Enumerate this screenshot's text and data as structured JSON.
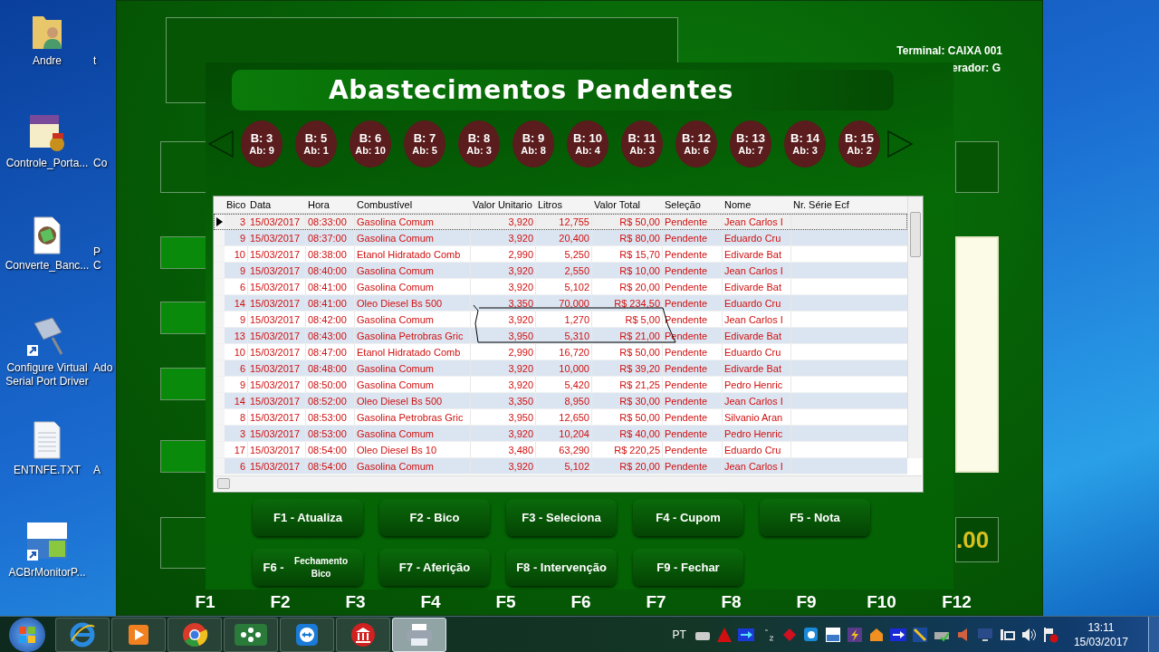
{
  "desktop_icons": [
    {
      "kind": "folder",
      "label": "Andre"
    },
    {
      "kind": "pas",
      "label": "Controle_Porta..."
    },
    {
      "kind": "doc",
      "label": "Converte_Banc..."
    },
    {
      "kind": "plug",
      "label": "Configure Virtual Serial Port Driver"
    },
    {
      "kind": "text",
      "label": "ENTNFE.TXT"
    },
    {
      "kind": "acbr",
      "label": "ACBrMonitorP..."
    }
  ],
  "desktop_icons_partial": [
    "t",
    "Co",
    "P\nC",
    "Ado",
    "A"
  ],
  "back_window": {
    "terminal": "Terminal: CAIXA 001",
    "operator": "erador: G",
    "total": ".00",
    "fkeys": [
      "F1",
      "F2",
      "F3",
      "F4",
      "F5",
      "F6",
      "F7",
      "F8",
      "F9",
      "F10",
      "F12"
    ]
  },
  "dialog": {
    "title": "Abastecimentos Pendentes",
    "bicos": [
      {
        "b": "B: 3",
        "ab": "Ab: 9"
      },
      {
        "b": "B: 5",
        "ab": "Ab: 1"
      },
      {
        "b": "B: 6",
        "ab": "Ab: 10"
      },
      {
        "b": "B: 7",
        "ab": "Ab: 5"
      },
      {
        "b": "B: 8",
        "ab": "Ab: 3"
      },
      {
        "b": "B: 9",
        "ab": "Ab: 8"
      },
      {
        "b": "B: 10",
        "ab": "Ab: 4"
      },
      {
        "b": "B: 11",
        "ab": "Ab: 3"
      },
      {
        "b": "B: 12",
        "ab": "Ab: 6"
      },
      {
        "b": "B: 13",
        "ab": "Ab: 7"
      },
      {
        "b": "B: 14",
        "ab": "Ab: 3"
      },
      {
        "b": "B: 15",
        "ab": "Ab: 2"
      }
    ],
    "table": {
      "columns": [
        "Bico",
        "Data",
        "Hora",
        "Combustível",
        "Valor Unitario",
        "Litros",
        "Valor Total",
        "Seleção",
        "Nome",
        "Nr. Série Ecf"
      ],
      "rows": [
        {
          "selected": true,
          "cells": [
            "3",
            "15/03/2017",
            "08:33:00",
            "Gasolina Comum",
            "3,920",
            "12,755",
            "R$ 50,00",
            "Pendente",
            "Jean Carlos I"
          ]
        },
        {
          "selected": false,
          "cells": [
            "9",
            "15/03/2017",
            "08:37:00",
            "Gasolina Comum",
            "3,920",
            "20,400",
            "R$ 80,00",
            "Pendente",
            "Eduardo Cru"
          ]
        },
        {
          "selected": false,
          "cells": [
            "10",
            "15/03/2017",
            "08:38:00",
            "Etanol Hidratado Comb",
            "2,990",
            "5,250",
            "R$ 15,70",
            "Pendente",
            "Edivarde Bat"
          ]
        },
        {
          "selected": false,
          "cells": [
            "9",
            "15/03/2017",
            "08:40:00",
            "Gasolina Comum",
            "3,920",
            "2,550",
            "R$ 10,00",
            "Pendente",
            "Jean Carlos I"
          ]
        },
        {
          "selected": false,
          "cells": [
            "6",
            "15/03/2017",
            "08:41:00",
            "Gasolina Comum",
            "3,920",
            "5,102",
            "R$ 20,00",
            "Pendente",
            "Edivarde Bat"
          ]
        },
        {
          "selected": false,
          "cells": [
            "14",
            "15/03/2017",
            "08:41:00",
            "Oleo Diesel Bs 500",
            "3,350",
            "70,000",
            "R$ 234,50",
            "Pendente",
            "Eduardo Cru"
          ]
        },
        {
          "selected": false,
          "cells": [
            "9",
            "15/03/2017",
            "08:42:00",
            "Gasolina Comum",
            "3,920",
            "1,270",
            "R$ 5,00",
            "Pendente",
            "Jean Carlos I"
          ]
        },
        {
          "selected": false,
          "cells": [
            "13",
            "15/03/2017",
            "08:43:00",
            "Gasolina Petrobras Gric",
            "3,950",
            "5,310",
            "R$ 21,00",
            "Pendente",
            "Edivarde Bat"
          ]
        },
        {
          "selected": false,
          "cells": [
            "10",
            "15/03/2017",
            "08:47:00",
            "Etanol Hidratado Comb",
            "2,990",
            "16,720",
            "R$ 50,00",
            "Pendente",
            "Eduardo Cru"
          ]
        },
        {
          "selected": false,
          "cells": [
            "6",
            "15/03/2017",
            "08:48:00",
            "Gasolina Comum",
            "3,920",
            "10,000",
            "R$ 39,20",
            "Pendente",
            "Edivarde Bat"
          ]
        },
        {
          "selected": false,
          "cells": [
            "9",
            "15/03/2017",
            "08:50:00",
            "Gasolina Comum",
            "3,920",
            "5,420",
            "R$ 21,25",
            "Pendente",
            "Pedro Henric"
          ]
        },
        {
          "selected": false,
          "cells": [
            "14",
            "15/03/2017",
            "08:52:00",
            "Oleo Diesel Bs 500",
            "3,350",
            "8,950",
            "R$ 30,00",
            "Pendente",
            "Jean Carlos I"
          ]
        },
        {
          "selected": false,
          "cells": [
            "8",
            "15/03/2017",
            "08:53:00",
            "Gasolina Petrobras Gric",
            "3,950",
            "12,650",
            "R$ 50,00",
            "Pendente",
            "Silvanio Aran"
          ]
        },
        {
          "selected": false,
          "cells": [
            "3",
            "15/03/2017",
            "08:53:00",
            "Gasolina Comum",
            "3,920",
            "10,204",
            "R$ 40,00",
            "Pendente",
            "Pedro Henric"
          ]
        },
        {
          "selected": false,
          "cells": [
            "17",
            "15/03/2017",
            "08:54:00",
            "Oleo Diesel Bs 10",
            "3,480",
            "63,290",
            "R$ 220,25",
            "Pendente",
            "Eduardo Cru"
          ]
        },
        {
          "selected": false,
          "cells": [
            "6",
            "15/03/2017",
            "08:54:00",
            "Gasolina Comum",
            "3,920",
            "5,102",
            "R$ 20,00",
            "Pendente",
            "Jean Carlos I"
          ]
        }
      ]
    },
    "buttons": [
      [
        {
          "label": "F1 - Atualiza"
        },
        {
          "label": "F2 - Bico"
        },
        {
          "label": "F3 - Seleciona"
        },
        {
          "label": "F4 - Cupom"
        },
        {
          "label": "F5 - Nota"
        }
      ],
      [
        {
          "label": "F6 -",
          "sub": "Fechamento Bico"
        },
        {
          "label": "F7 - Aferição"
        },
        {
          "label": "F8 - Intervenção"
        },
        {
          "label": "F9 - Fechar"
        }
      ]
    ]
  },
  "taskbar": {
    "apps": [
      {
        "kind": "ie",
        "active": false
      },
      {
        "kind": "media",
        "active": false
      },
      {
        "kind": "chrome",
        "active": false
      },
      {
        "kind": "ib",
        "active": false
      },
      {
        "kind": "teamviewer",
        "active": false
      },
      {
        "kind": "bank",
        "active": false
      },
      {
        "kind": "printer",
        "active": true
      }
    ],
    "language": "PT",
    "time": "13:11",
    "date": "15/03/2017"
  }
}
